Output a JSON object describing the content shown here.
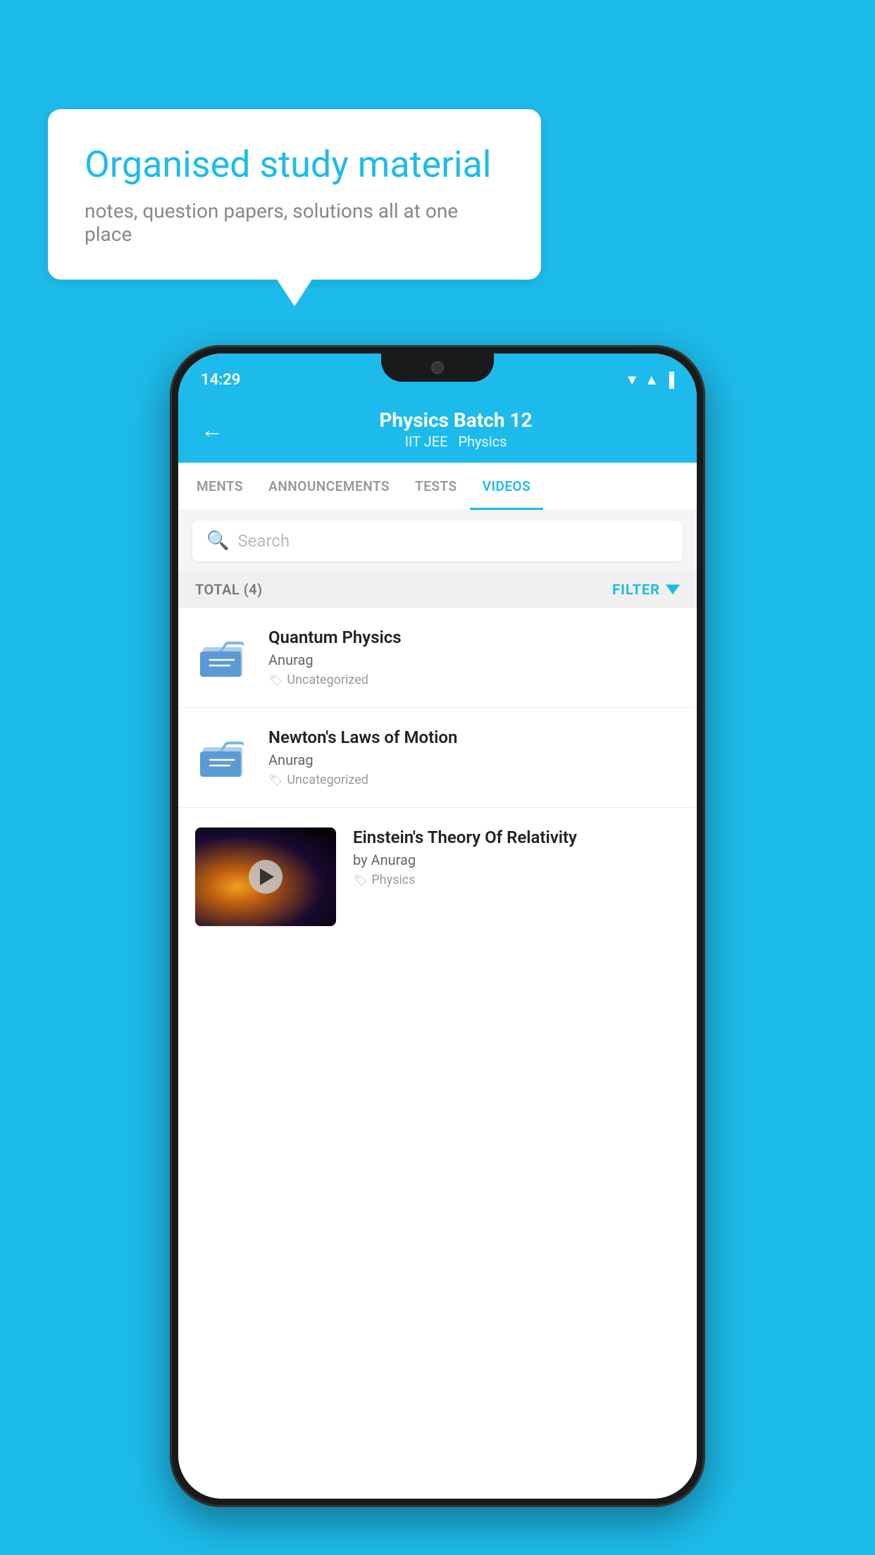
{
  "background_color": "#1DBBEB",
  "bubble": {
    "title": "Organised study material",
    "subtitle": "notes, question papers, solutions all at one place"
  },
  "phone": {
    "status_bar": {
      "time": "14:29"
    },
    "header": {
      "title": "Physics Batch 12",
      "subtitle_parts": [
        "IIT JEE",
        "Physics"
      ],
      "back_label": "←"
    },
    "tabs": [
      {
        "label": "MENTS",
        "active": false
      },
      {
        "label": "ANNOUNCEMENTS",
        "active": false
      },
      {
        "label": "TESTS",
        "active": false
      },
      {
        "label": "VIDEOS",
        "active": true
      }
    ],
    "search": {
      "placeholder": "Search"
    },
    "filter_bar": {
      "total_label": "TOTAL (4)",
      "filter_label": "FILTER"
    },
    "videos": [
      {
        "id": "quantum",
        "title": "Quantum Physics",
        "author": "Anurag",
        "tag": "Uncategorized",
        "type": "folder",
        "has_thumb": false
      },
      {
        "id": "newton",
        "title": "Newton's Laws of Motion",
        "author": "Anurag",
        "tag": "Uncategorized",
        "type": "folder",
        "has_thumb": false
      },
      {
        "id": "einstein",
        "title": "Einstein's Theory Of Relativity",
        "author": "by Anurag",
        "tag": "Physics",
        "type": "video",
        "has_thumb": true
      }
    ]
  }
}
